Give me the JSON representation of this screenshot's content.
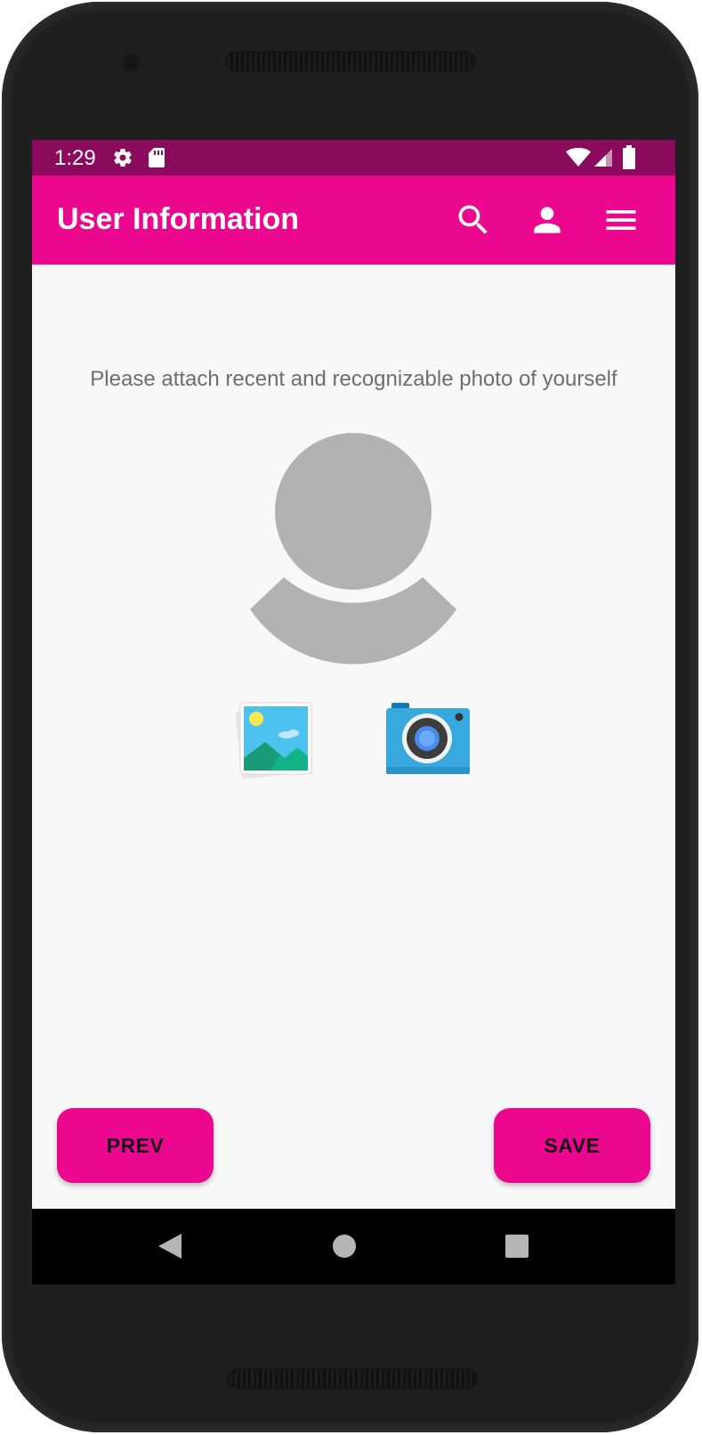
{
  "status_bar": {
    "time": "1:29",
    "left_icons": [
      "gear-icon",
      "sd-card-icon"
    ],
    "right_icons": [
      "wifi-icon",
      "signal-icon",
      "battery-icon"
    ]
  },
  "app_bar": {
    "title": "User Information",
    "actions": [
      "search-icon",
      "person-icon",
      "menu-icon"
    ],
    "color": "#ec088e",
    "status_color": "#8b0a5e"
  },
  "content": {
    "prompt": "Please attach recent and recognizable photo of yourself",
    "avatar_icon": "default-avatar-icon",
    "source_options": [
      "gallery-icon",
      "camera-icon"
    ]
  },
  "buttons": {
    "prev_label": "PREV",
    "save_label": "SAVE"
  },
  "nav_bar": {
    "buttons": [
      "back-icon",
      "home-icon",
      "recents-icon"
    ]
  }
}
